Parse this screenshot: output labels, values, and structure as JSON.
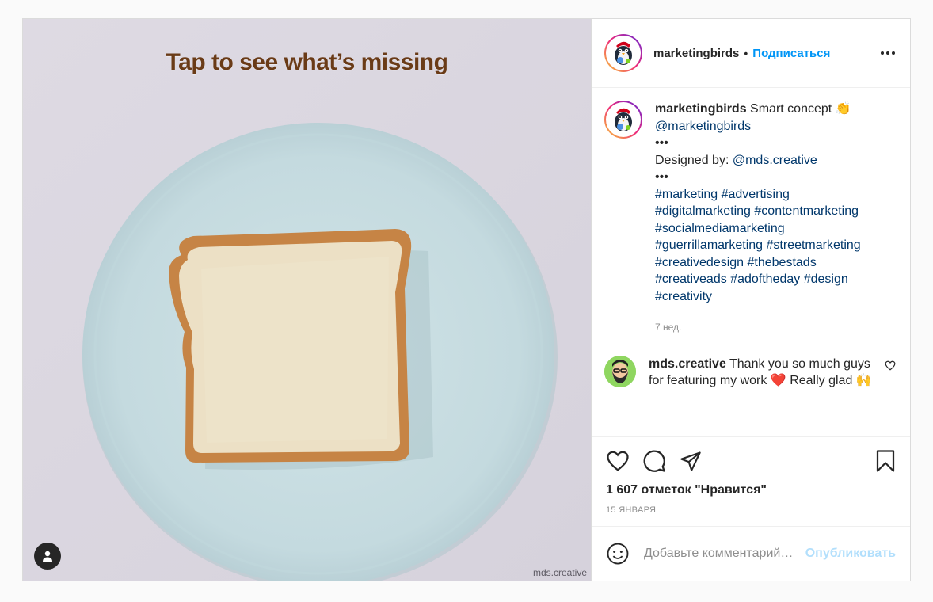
{
  "media": {
    "overlay_title": "Tap to see what’s missing",
    "watermark": "mds.creative",
    "colors": {
      "background": "#ddd9e2",
      "plate": "#c6dde2",
      "bread_crust": "#c98a4e",
      "bread_inside": "#eee2c8"
    }
  },
  "header": {
    "username": "marketingbirds",
    "separator": "•",
    "follow_label": "Подписаться"
  },
  "caption": {
    "username": "marketingbirds",
    "text": "Smart concept 👏",
    "mention": "@marketingbirds",
    "dots1": "•••",
    "designed_by_label": "Designed by:",
    "designed_by_link": "@mds.creative",
    "dots2": "•••",
    "hashtag_lines": [
      "#marketing #advertising",
      "#digitalmarketing #contentmarketing",
      "#socialmediamarketing",
      "#guerrillamarketing #streetmarketing",
      "#creativedesign #thebestads",
      "#creativeads #adoftheday #design",
      "#creativity"
    ],
    "time": "7 нед."
  },
  "reply": {
    "username": "mds.creative",
    "text": "Thank you so much guys for featuring my work ❤️ Really glad 🙌"
  },
  "actions": {
    "likes": "1 607 отметок \"Нравится\"",
    "date": "15 ЯНВАРЯ"
  },
  "comment_box": {
    "placeholder": "Добавьте комментарий…",
    "publish_label": "Опубликовать"
  }
}
